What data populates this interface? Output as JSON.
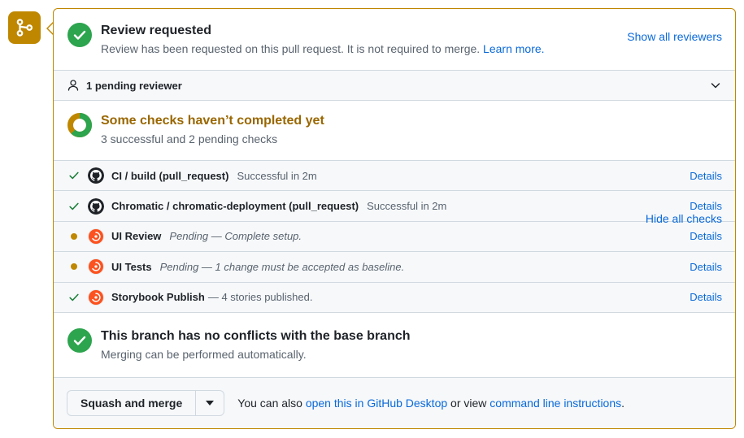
{
  "timeline_badge": {
    "icon": "git-merge-icon",
    "color": "#bf8700"
  },
  "review": {
    "title": "Review requested",
    "subtitle": "Review has been requested on this pull request. It is not required to merge.",
    "learn_more": "Learn more.",
    "show_all_reviewers": "Show all reviewers",
    "pending_reviewer": "1 pending reviewer"
  },
  "checks": {
    "title": "Some checks haven’t completed yet",
    "subtitle": "3 successful and 2 pending checks",
    "hide_all": "Hide all checks",
    "details_label": "Details",
    "rows": [
      {
        "status": "success",
        "avatar": "github-avatar",
        "name": "CI / build (pull_request)",
        "desc": "Successful in 2m",
        "desc_style": "normal",
        "details": "Details"
      },
      {
        "status": "success",
        "avatar": "github-avatar",
        "name": "Chromatic / chromatic-deployment (pull_request)",
        "desc": "Successful in 2m",
        "desc_style": "normal",
        "details": "Details"
      },
      {
        "status": "pending",
        "avatar": "chromatic-avatar",
        "name": "UI Review",
        "desc": "Pending — Complete setup.",
        "desc_style": "italic",
        "details": "Details"
      },
      {
        "status": "pending",
        "avatar": "chromatic-avatar",
        "name": "UI Tests",
        "desc": "Pending — 1 change must be accepted as baseline.",
        "desc_style": "italic",
        "details": "Details"
      },
      {
        "status": "success",
        "avatar": "chromatic-avatar",
        "name": "Storybook Publish",
        "desc": "— 4 stories published.",
        "desc_style": "inline",
        "details": "Details"
      }
    ]
  },
  "conflicts": {
    "title": "This branch has no conflicts with the base branch",
    "subtitle": "Merging can be performed automatically."
  },
  "footer": {
    "merge_button": "Squash and merge",
    "note_prefix": "You can also ",
    "desktop_link": "open this in GitHub Desktop",
    "note_middle": " or view ",
    "cli_link": "command line instructions",
    "note_suffix": "."
  },
  "colors": {
    "border": "#bf8700",
    "success": "#1a7f37",
    "pending": "#bf8700",
    "link": "#0969da",
    "warn_text": "#9a6700"
  }
}
